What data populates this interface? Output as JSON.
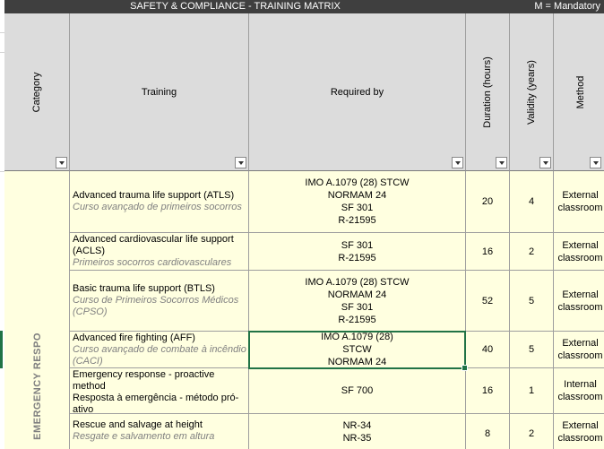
{
  "sheet": {
    "title": "SAFETY & COMPLIANCE - TRAINING MATRIX",
    "legend": "M = Mandatory",
    "colors": {
      "header_bg": "#dcdcdc",
      "title_bg": "#3f3f3f",
      "cell_bg": "#ffffe0",
      "selection": "#217346",
      "translation_text": "#808080"
    }
  },
  "columns": {
    "category": "Category",
    "training": "Training",
    "required_by": "Required by",
    "duration": "Duration (hours)",
    "validity": "Validity (years)",
    "method": "Method"
  },
  "category_group": "EMERGENCY RESPO",
  "rows": [
    {
      "training_en": "Advanced trauma life support (ATLS)",
      "training_pt": "Curso avançado de primeiros socorros",
      "required_by": [
        "IMO A.1079 (28) STCW",
        "NORMAM 24",
        "SF 301",
        "R-21595"
      ],
      "duration": "20",
      "validity": "4",
      "method": [
        "External",
        "classroom"
      ]
    },
    {
      "training_en": "Advanced cardiovascular life support (ACLS)",
      "training_pt": "Primeiros socorros cardiovasculares",
      "required_by": [
        "SF 301",
        "R-21595"
      ],
      "duration": "16",
      "validity": "2",
      "method": [
        "External",
        "classroom"
      ]
    },
    {
      "training_en": "Basic trauma life support (BTLS)",
      "training_pt": "Curso de Primeiros Socorros Médicos (CPSO)",
      "required_by": [
        "IMO A.1079 (28) STCW",
        "NORMAM 24",
        "SF 301",
        "R-21595"
      ],
      "duration": "52",
      "validity": "5",
      "method": [
        "External",
        "classroom"
      ]
    },
    {
      "training_en": "Advanced fire fighting (AFF)",
      "training_pt": "Curso avançado de combate à incêndio (CACI)",
      "required_by": [
        "IMO A.1079 (28)",
        "STCW",
        "NORMAM 24"
      ],
      "duration": "40",
      "validity": "5",
      "method": [
        "External",
        "classroom"
      ]
    },
    {
      "training_en": "Emergency response - proactive method",
      "training_en2": "Resposta à emergência - método pró-ativo",
      "required_by": [
        "SF 700"
      ],
      "duration": "16",
      "validity": "1",
      "method": [
        "Internal",
        "classroom"
      ]
    },
    {
      "training_en": "Rescue and salvage at height",
      "training_pt": "Resgate e salvamento em altura",
      "required_by": [
        "NR-34",
        "NR-35"
      ],
      "duration": "8",
      "validity": "2",
      "method": [
        "External",
        "classroom"
      ]
    }
  ]
}
